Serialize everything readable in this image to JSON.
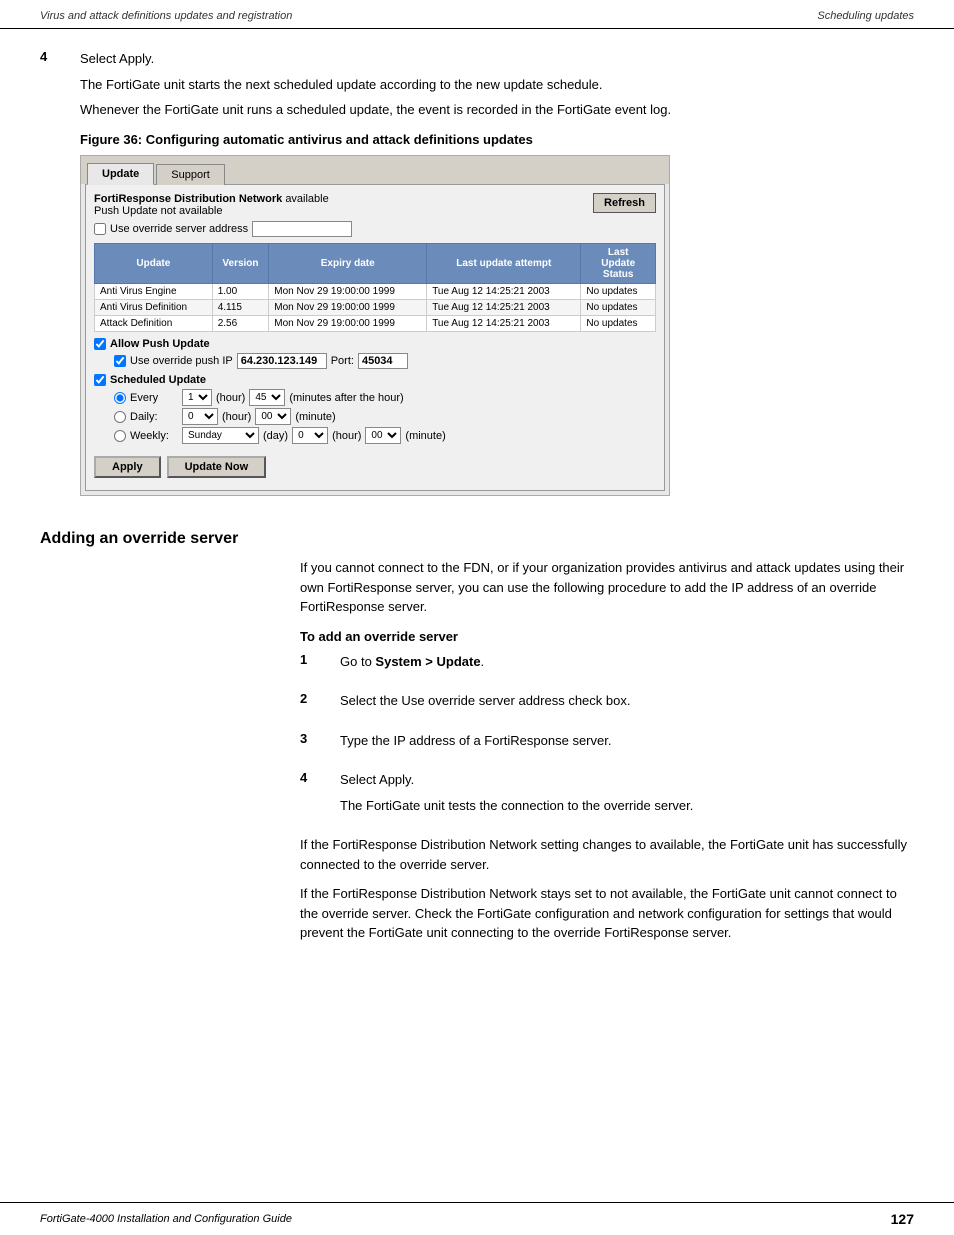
{
  "header": {
    "left": "Virus and attack definitions updates and registration",
    "right": "Scheduling updates"
  },
  "footer": {
    "left": "FortiGate-4000 Installation and Configuration Guide",
    "page": "127"
  },
  "step4": {
    "num": "4",
    "line1": "Select Apply.",
    "line2": "The FortiGate unit starts the next scheduled update according to the new update schedule.",
    "line3": "Whenever the FortiGate unit runs a scheduled update, the event is recorded in the FortiGate event log."
  },
  "figure": {
    "caption": "Figure 36: Configuring automatic antivirus and attack definitions updates",
    "tabs": [
      "Update",
      "Support"
    ],
    "active_tab": "Update",
    "fdn_label": "FortiResponse Distribution Network",
    "fdn_status": "available",
    "push_update_label": "Push Update",
    "push_update_status": "not available",
    "refresh_btn": "Refresh",
    "override_label": "Use override server address",
    "table": {
      "headers": [
        "Update",
        "Version",
        "Expiry date",
        "Last update attempt",
        "Last Update Status"
      ],
      "rows": [
        [
          "Anti Virus Engine",
          "1.00",
          "Mon Nov 29 19:00:00 1999",
          "Tue Aug 12 14:25:21 2003",
          "No updates"
        ],
        [
          "Anti Virus Definition",
          "4.115",
          "Mon Nov 29 19:00:00 1999",
          "Tue Aug 12 14:25:21 2003",
          "No updates"
        ],
        [
          "Attack Definition",
          "2.56",
          "Mon Nov 29 19:00:00 1999",
          "Tue Aug 12 14:25:21 2003",
          "No updates"
        ]
      ]
    },
    "allow_push": {
      "label": "Allow Push Update",
      "checked": true,
      "sub_label": "Use override push IP",
      "sub_checked": true,
      "ip_value": "64.230.123.149",
      "port_label": "Port:",
      "port_value": "45034"
    },
    "scheduled": {
      "label": "Scheduled Update",
      "checked": true,
      "every": {
        "label": "Every",
        "hour_value": "1",
        "minute_value": "45",
        "hour_label": "(hour)",
        "minute_label": "(minutes after the hour)"
      },
      "daily": {
        "label": "Daily:",
        "hour_value": "0",
        "minute_value": "00",
        "hour_label": "(hour)",
        "minute_label": "(minute)"
      },
      "weekly": {
        "label": "Weekly:",
        "day_value": "Sunday",
        "hour_value": "0",
        "minute_value": "00",
        "day_label": "(day)",
        "hour_label": "(hour)",
        "minute_label": "(minute)"
      }
    },
    "apply_btn": "Apply",
    "update_now_btn": "Update Now"
  },
  "adding_override": {
    "title": "Adding an override server",
    "intro": "If you cannot connect to the FDN, or if your organization provides antivirus and attack updates using their own FortiResponse server, you can use the following procedure to add the IP address of an override FortiResponse server.",
    "sub_title": "To add an override server",
    "steps": [
      {
        "num": "1",
        "text": "Go to System > Update."
      },
      {
        "num": "2",
        "text": "Select the Use override server address check box."
      },
      {
        "num": "3",
        "text": "Type the IP address of a FortiResponse server."
      },
      {
        "num": "4",
        "text": "Select Apply.",
        "sub": "The FortiGate unit tests the connection to the override server."
      }
    ],
    "para1": "If the FortiResponse Distribution Network setting changes to available, the FortiGate unit has successfully connected to the override server.",
    "para2": "If the FortiResponse Distribution Network stays set to not available, the FortiGate unit cannot connect to the override server. Check the FortiGate configuration and network configuration for settings that would prevent the FortiGate unit connecting to the override FortiResponse server."
  }
}
